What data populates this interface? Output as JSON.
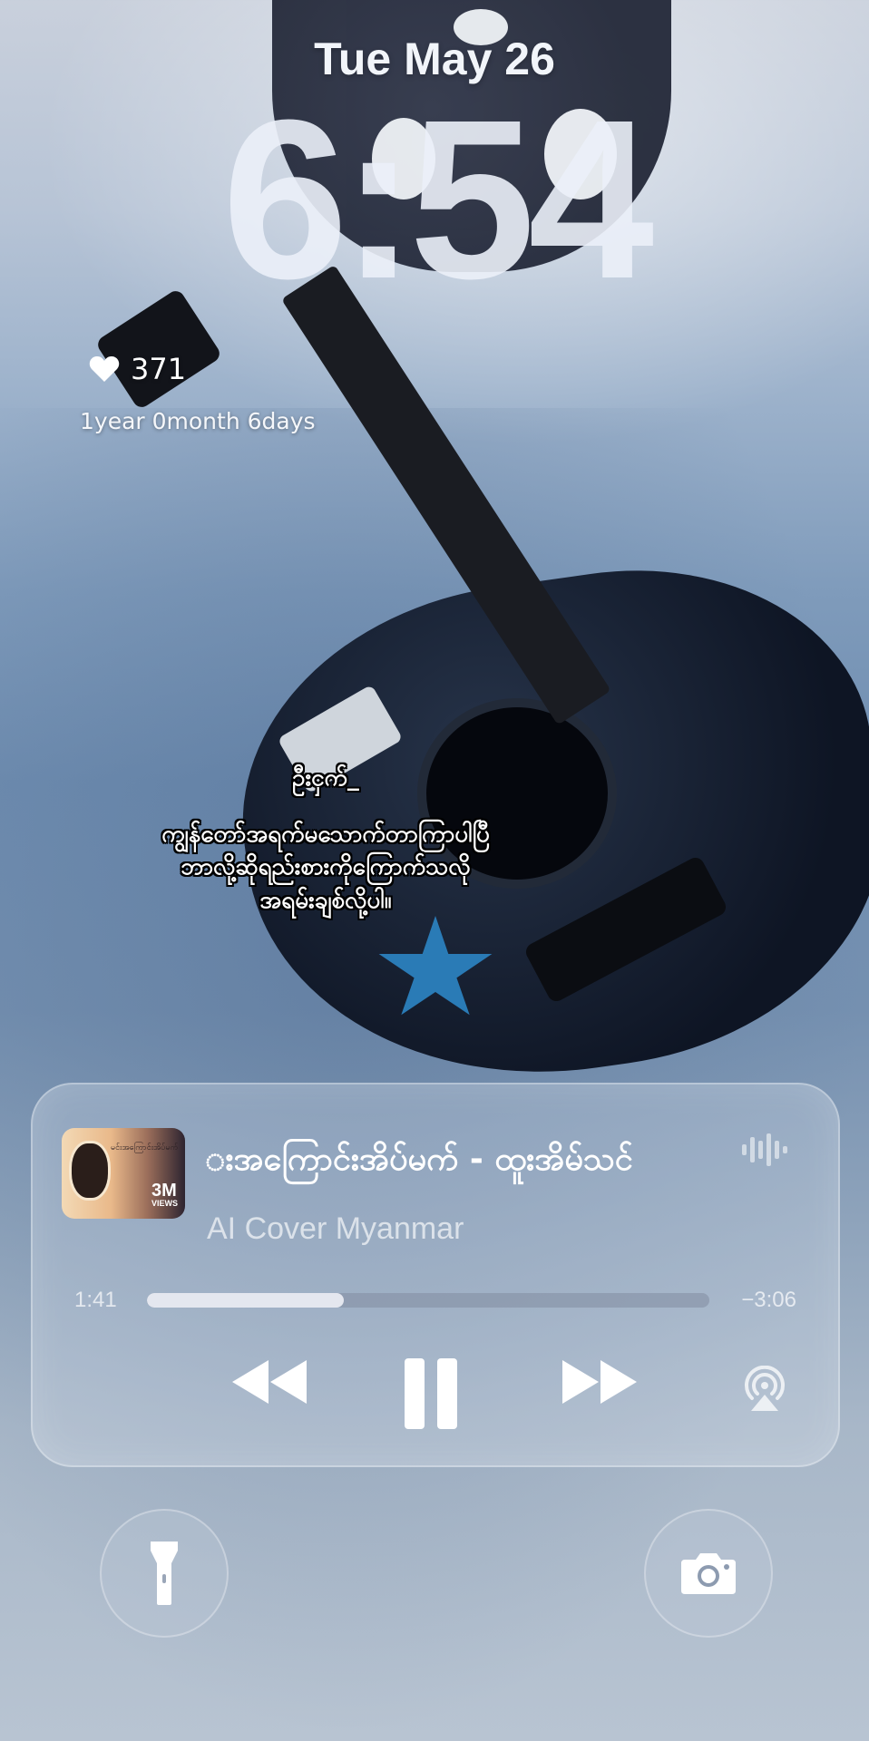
{
  "lock_screen": {
    "date": "Tue May 26",
    "time": "6:54"
  },
  "widget": {
    "likes": "371",
    "duration": "1year 0month 6days",
    "icon": "heart-icon"
  },
  "lyrics": {
    "title": "ဦးငှက်_",
    "line1": "ကျွန်တော်အရက်မသောက်တာကြာပါပြီ",
    "line2": "ဘာလို့ဆိုရည်းစားကိုကြောက်သလို",
    "line3": "အရမ်းချစ်လို့ပါ။"
  },
  "now_playing": {
    "title": "းအကြောင်းအိပ်မက် - ထူးအိမ်သင်",
    "artist": "AI Cover Myanmar",
    "elapsed": "1:41",
    "remaining": "−3:06",
    "progress": 0.35,
    "artwork_text": "မင်းအကြောင်းအိပ်မက်",
    "artwork_badge": "3M",
    "artwork_badge_sub": "VIEWS",
    "icons": [
      "waveform-icon",
      "rewind-icon",
      "pause-icon",
      "fast-forward-icon",
      "airplay-icon"
    ]
  },
  "quick_actions": {
    "left": "flashlight-icon",
    "right": "camera-icon"
  }
}
